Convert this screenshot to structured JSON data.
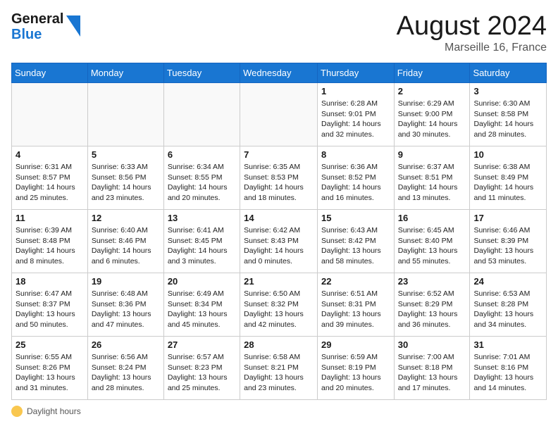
{
  "header": {
    "logo_general": "General",
    "logo_blue": "Blue",
    "month": "August 2024",
    "location": "Marseille 16, France"
  },
  "days": [
    "Sunday",
    "Monday",
    "Tuesday",
    "Wednesday",
    "Thursday",
    "Friday",
    "Saturday"
  ],
  "footer": {
    "note": "Daylight hours"
  },
  "weeks": [
    [
      {
        "date": "",
        "info": ""
      },
      {
        "date": "",
        "info": ""
      },
      {
        "date": "",
        "info": ""
      },
      {
        "date": "",
        "info": ""
      },
      {
        "date": "1",
        "info": "Sunrise: 6:28 AM\nSunset: 9:01 PM\nDaylight: 14 hours and 32 minutes."
      },
      {
        "date": "2",
        "info": "Sunrise: 6:29 AM\nSunset: 9:00 PM\nDaylight: 14 hours and 30 minutes."
      },
      {
        "date": "3",
        "info": "Sunrise: 6:30 AM\nSunset: 8:58 PM\nDaylight: 14 hours and 28 minutes."
      }
    ],
    [
      {
        "date": "4",
        "info": "Sunrise: 6:31 AM\nSunset: 8:57 PM\nDaylight: 14 hours and 25 minutes."
      },
      {
        "date": "5",
        "info": "Sunrise: 6:33 AM\nSunset: 8:56 PM\nDaylight: 14 hours and 23 minutes."
      },
      {
        "date": "6",
        "info": "Sunrise: 6:34 AM\nSunset: 8:55 PM\nDaylight: 14 hours and 20 minutes."
      },
      {
        "date": "7",
        "info": "Sunrise: 6:35 AM\nSunset: 8:53 PM\nDaylight: 14 hours and 18 minutes."
      },
      {
        "date": "8",
        "info": "Sunrise: 6:36 AM\nSunset: 8:52 PM\nDaylight: 14 hours and 16 minutes."
      },
      {
        "date": "9",
        "info": "Sunrise: 6:37 AM\nSunset: 8:51 PM\nDaylight: 14 hours and 13 minutes."
      },
      {
        "date": "10",
        "info": "Sunrise: 6:38 AM\nSunset: 8:49 PM\nDaylight: 14 hours and 11 minutes."
      }
    ],
    [
      {
        "date": "11",
        "info": "Sunrise: 6:39 AM\nSunset: 8:48 PM\nDaylight: 14 hours and 8 minutes."
      },
      {
        "date": "12",
        "info": "Sunrise: 6:40 AM\nSunset: 8:46 PM\nDaylight: 14 hours and 6 minutes."
      },
      {
        "date": "13",
        "info": "Sunrise: 6:41 AM\nSunset: 8:45 PM\nDaylight: 14 hours and 3 minutes."
      },
      {
        "date": "14",
        "info": "Sunrise: 6:42 AM\nSunset: 8:43 PM\nDaylight: 14 hours and 0 minutes."
      },
      {
        "date": "15",
        "info": "Sunrise: 6:43 AM\nSunset: 8:42 PM\nDaylight: 13 hours and 58 minutes."
      },
      {
        "date": "16",
        "info": "Sunrise: 6:45 AM\nSunset: 8:40 PM\nDaylight: 13 hours and 55 minutes."
      },
      {
        "date": "17",
        "info": "Sunrise: 6:46 AM\nSunset: 8:39 PM\nDaylight: 13 hours and 53 minutes."
      }
    ],
    [
      {
        "date": "18",
        "info": "Sunrise: 6:47 AM\nSunset: 8:37 PM\nDaylight: 13 hours and 50 minutes."
      },
      {
        "date": "19",
        "info": "Sunrise: 6:48 AM\nSunset: 8:36 PM\nDaylight: 13 hours and 47 minutes."
      },
      {
        "date": "20",
        "info": "Sunrise: 6:49 AM\nSunset: 8:34 PM\nDaylight: 13 hours and 45 minutes."
      },
      {
        "date": "21",
        "info": "Sunrise: 6:50 AM\nSunset: 8:32 PM\nDaylight: 13 hours and 42 minutes."
      },
      {
        "date": "22",
        "info": "Sunrise: 6:51 AM\nSunset: 8:31 PM\nDaylight: 13 hours and 39 minutes."
      },
      {
        "date": "23",
        "info": "Sunrise: 6:52 AM\nSunset: 8:29 PM\nDaylight: 13 hours and 36 minutes."
      },
      {
        "date": "24",
        "info": "Sunrise: 6:53 AM\nSunset: 8:28 PM\nDaylight: 13 hours and 34 minutes."
      }
    ],
    [
      {
        "date": "25",
        "info": "Sunrise: 6:55 AM\nSunset: 8:26 PM\nDaylight: 13 hours and 31 minutes."
      },
      {
        "date": "26",
        "info": "Sunrise: 6:56 AM\nSunset: 8:24 PM\nDaylight: 13 hours and 28 minutes."
      },
      {
        "date": "27",
        "info": "Sunrise: 6:57 AM\nSunset: 8:23 PM\nDaylight: 13 hours and 25 minutes."
      },
      {
        "date": "28",
        "info": "Sunrise: 6:58 AM\nSunset: 8:21 PM\nDaylight: 13 hours and 23 minutes."
      },
      {
        "date": "29",
        "info": "Sunrise: 6:59 AM\nSunset: 8:19 PM\nDaylight: 13 hours and 20 minutes."
      },
      {
        "date": "30",
        "info": "Sunrise: 7:00 AM\nSunset: 8:18 PM\nDaylight: 13 hours and 17 minutes."
      },
      {
        "date": "31",
        "info": "Sunrise: 7:01 AM\nSunset: 8:16 PM\nDaylight: 13 hours and 14 minutes."
      }
    ]
  ]
}
